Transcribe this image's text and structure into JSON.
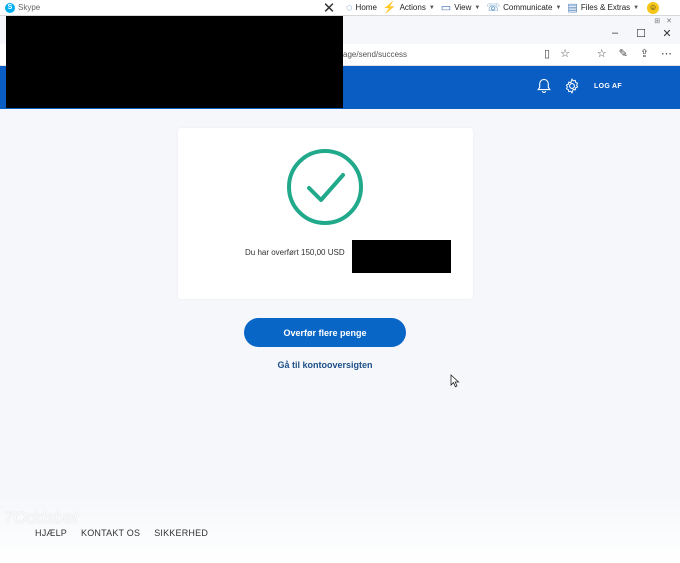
{
  "skype_toolbar": {
    "title": "Skype",
    "items": [
      {
        "label": "Home",
        "icon": "home-icon"
      },
      {
        "label": "Actions",
        "icon": "lightning-icon"
      },
      {
        "label": "View",
        "icon": "monitor-icon"
      },
      {
        "label": "Communicate",
        "icon": "phone-icon"
      },
      {
        "label": "Files & Extras",
        "icon": "files-icon"
      }
    ]
  },
  "browser": {
    "url": "age/send/success"
  },
  "header": {
    "logout_label": "LOG AF"
  },
  "card": {
    "success_text": "Du har overført 150,00 USD"
  },
  "actions": {
    "primary_label": "Overfør flere penge",
    "secondary_label": "Gå til kontooversigten"
  },
  "watermark_text": "7Oddsbet",
  "footer": {
    "links": [
      "HJÆLP",
      "KONTAKT OS",
      "SIKKERHED"
    ]
  },
  "colors": {
    "header_blue": "#0a5dc2",
    "button_blue": "#0866c6",
    "success_green": "#20a98a"
  }
}
